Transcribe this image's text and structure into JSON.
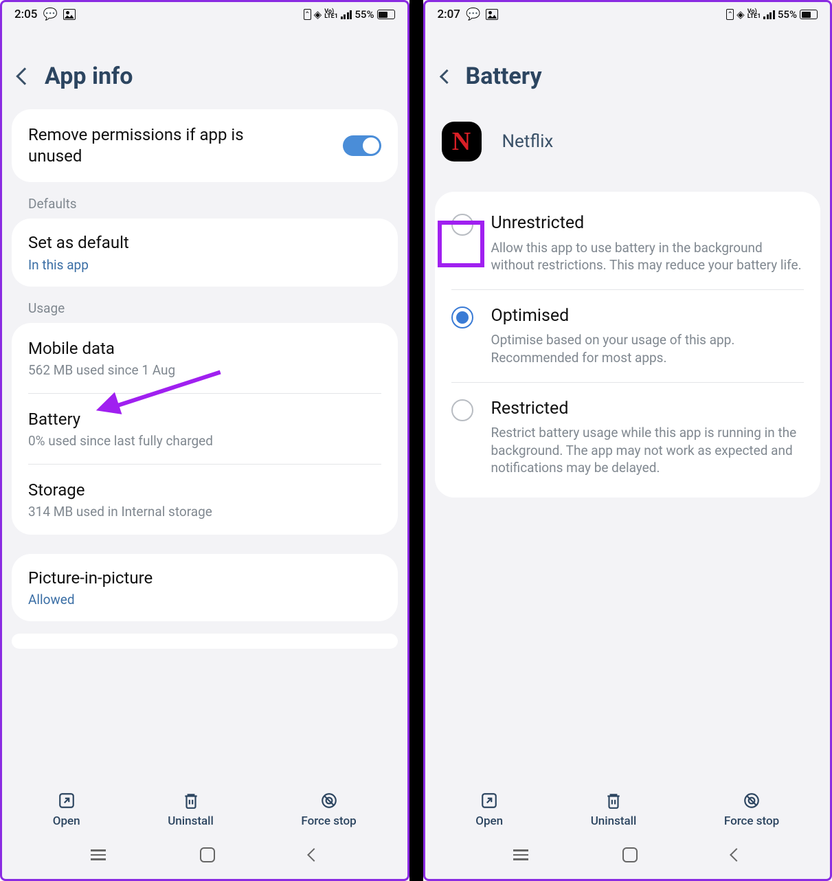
{
  "left": {
    "status": {
      "time": "2:05",
      "battery": "55%",
      "lte": "Vo)\nLTE1"
    },
    "header": {
      "title": "App info"
    },
    "remove_perm": {
      "title": "Remove permissions if app is unused"
    },
    "sections": {
      "defaults_label": "Defaults",
      "set_default": {
        "title": "Set as default",
        "sub": "In this app"
      },
      "usage_label": "Usage",
      "mobile_data": {
        "title": "Mobile data",
        "sub": "562 MB used since 1 Aug"
      },
      "battery": {
        "title": "Battery",
        "sub": "0% used since last fully charged"
      },
      "storage": {
        "title": "Storage",
        "sub": "314 MB used in Internal storage"
      },
      "pip": {
        "title": "Picture-in-picture",
        "sub": "Allowed"
      }
    },
    "actions": {
      "open": "Open",
      "uninstall": "Uninstall",
      "force_stop": "Force stop"
    }
  },
  "right": {
    "status": {
      "time": "2:07",
      "battery": "55%",
      "lte": "Vo)\nLTE1"
    },
    "header": {
      "title": "Battery"
    },
    "app": {
      "name": "Netflix",
      "letter": "N"
    },
    "options": {
      "unrestricted": {
        "title": "Unrestricted",
        "desc": "Allow this app to use battery in the background without restrictions. This may reduce your battery life."
      },
      "optimised": {
        "title": "Optimised",
        "desc": "Optimise based on your usage of this app. Recommended for most apps."
      },
      "restricted": {
        "title": "Restricted",
        "desc": "Restrict battery usage while this app is running in the background. The app may not work as expected and notifications may be delayed."
      }
    },
    "actions": {
      "open": "Open",
      "uninstall": "Uninstall",
      "force_stop": "Force stop"
    }
  }
}
